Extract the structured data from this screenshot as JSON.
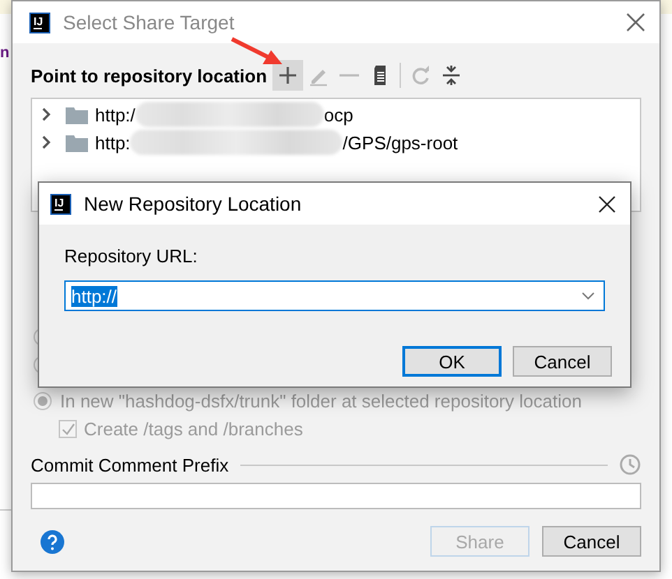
{
  "dialog": {
    "background_text": "n",
    "logo": "IJ",
    "title": "Select Share Target",
    "section_label": "Point to repository location",
    "toolbar": [
      {
        "kind": "add",
        "disabled": false,
        "hovered": true
      },
      {
        "kind": "edit",
        "disabled": true,
        "hovered": false
      },
      {
        "kind": "remove",
        "disabled": true,
        "hovered": false
      },
      {
        "kind": "browse",
        "disabled": false,
        "hovered": false
      },
      {
        "kind": "refresh",
        "disabled": true,
        "hovered": false
      },
      {
        "kind": "collapse",
        "disabled": false,
        "hovered": false
      }
    ],
    "repositories": [
      {
        "prefix": "http:/",
        "suffix": "ocp",
        "expanded": false
      },
      {
        "prefix": "http:",
        "suffix": "/GPS/gps-root",
        "expanded": false
      }
    ],
    "location_options": [
      {
        "disabled": true
      },
      {
        "disabled": true
      },
      {
        "label": "In new \"hashdog-dsfx/trunk\" folder at selected repository location",
        "selected": true,
        "disabled": true
      }
    ],
    "create_tags": {
      "label": "Create /tags and /branches",
      "checked": true,
      "disabled": true
    },
    "commit_prefix": {
      "label": "Commit Comment Prefix"
    },
    "buttons": [
      {
        "label": "Share",
        "disabled": true
      },
      {
        "label": "Cancel",
        "disabled": false
      }
    ]
  },
  "popup": {
    "logo": "IJ",
    "title": "New Repository Location",
    "field_label": "Repository URL:",
    "url": {
      "value": "http://",
      "text_selected": true
    },
    "buttons": [
      {
        "label": "OK",
        "default": true
      },
      {
        "label": "Cancel",
        "default": false
      }
    ]
  }
}
